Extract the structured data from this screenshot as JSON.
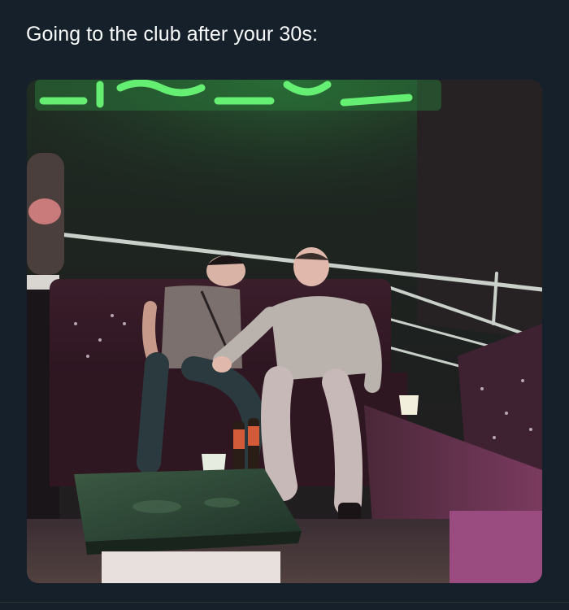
{
  "post": {
    "text": "Going to the club after your 30s:",
    "media": {
      "kind": "photo",
      "scene": "nightclub-booth"
    }
  },
  "colors": {
    "background": "#15202b",
    "text": "#f7f9f9",
    "neon_sign": "#39e05a",
    "sofa": "#3a1f2c",
    "table_top": "#2f4a3a"
  }
}
